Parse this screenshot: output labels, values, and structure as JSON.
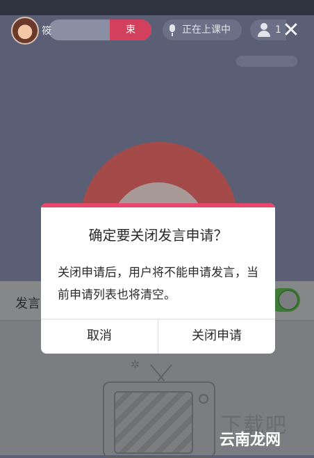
{
  "header": {
    "host_name": "筱",
    "end_label": "束",
    "status_label": "正在上课中",
    "online_count": "1",
    "close_icon": "close-icon"
  },
  "id_badge": "",
  "speak_row": {
    "label": "发言"
  },
  "dialog": {
    "title": "确定要关闭发言申请？",
    "body": "关闭申请后，用户将不能申请发言，当前申请列表也将清空。",
    "cancel_label": "取消",
    "confirm_label": "关闭申请",
    "accent_color": "#e8466b"
  },
  "watermark": {
    "text": "下载吧",
    "logo": "云南龙网"
  },
  "icons": [
    "avatar",
    "mic-icon",
    "user-icon",
    "close-icon",
    "tv-illustration"
  ]
}
